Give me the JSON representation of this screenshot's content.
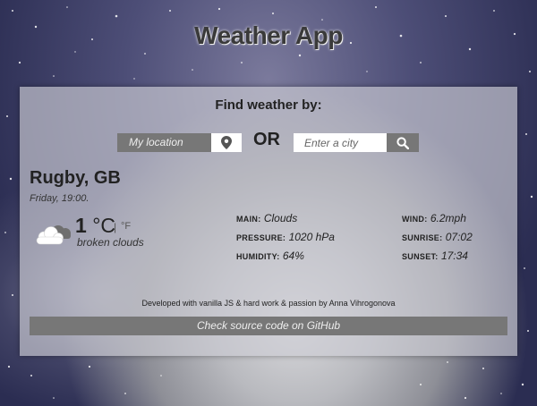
{
  "app": {
    "title": "Weather App"
  },
  "search": {
    "heading": "Find weather by:",
    "my_location_label": "My location",
    "or_label": "OR",
    "city_placeholder": "Enter a city",
    "city_value": ""
  },
  "weather": {
    "city": "Rugby, GB",
    "datetime": "Friday, 19:00.",
    "temperature": "1",
    "unit_c": "°C",
    "unit_separator": "|",
    "unit_f": "°F",
    "description": "broken clouds",
    "icon": "broken-clouds-icon"
  },
  "stats": {
    "main_label": "MAIN:",
    "main_value": "Clouds",
    "pressure_label": "PRESSURE:",
    "pressure_value": "1020 hPa",
    "humidity_label": "HUMIDITY:",
    "humidity_value": "64%",
    "wind_label": "WIND:",
    "wind_value": "6.2mph",
    "sunrise_label": "SUNRISE:",
    "sunrise_value": "07:02",
    "sunset_label": "SUNSET:",
    "sunset_value": "17:34"
  },
  "footer": {
    "credit": "Developed with vanilla JS & hard work & passion by Anna Vihrogonova",
    "github_label": "Check source code on GitHub"
  },
  "colors": {
    "button_gray": "#777777",
    "card_bg": "#cdcdd4",
    "title_text": "#3a3a3a"
  }
}
